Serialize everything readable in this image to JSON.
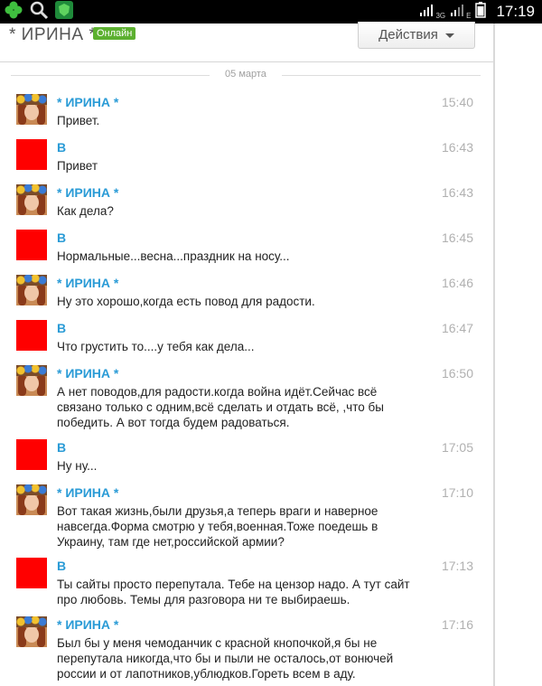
{
  "status_bar": {
    "time": "17:19",
    "network_1": "3G",
    "network_2": "E",
    "icons": [
      "clover-icon",
      "search-icon",
      "shield-app-icon",
      "signal-icon",
      "signal-icon",
      "battery-icon"
    ]
  },
  "header": {
    "chat_name": "* ИРИНА *",
    "online_badge": "Онлайн",
    "actions_label": "Действия"
  },
  "date_separator": "05 марта",
  "messages": [
    {
      "sender": "* ИРИНА *",
      "time": "15:40",
      "text": "Привет.",
      "avatar": "irina"
    },
    {
      "sender": "В",
      "time": "16:43",
      "text": "Привет",
      "avatar": "v"
    },
    {
      "sender": "* ИРИНА *",
      "time": "16:43",
      "text": "Как дела?",
      "avatar": "irina"
    },
    {
      "sender": "В",
      "time": "16:45",
      "text": "Нормальные...весна...праздник на носу...",
      "avatar": "v"
    },
    {
      "sender": "* ИРИНА *",
      "time": "16:46",
      "text": "Ну это хорошо,когда есть повод для радости.",
      "avatar": "irina"
    },
    {
      "sender": "В",
      "time": "16:47",
      "text": "Что грустить то....у тебя как дела...",
      "avatar": "v"
    },
    {
      "sender": "* ИРИНА *",
      "time": "16:50",
      "text": "А нет поводов,для радости.когда война идёт.Сейчас всё связано только с одним,всё сделать и отдать всё, ,что бы победить. А вот тогда будем радоваться.",
      "avatar": "irina"
    },
    {
      "sender": "В",
      "time": "17:05",
      "text": "Ну ну...",
      "avatar": "v"
    },
    {
      "sender": "* ИРИНА *",
      "time": "17:10",
      "text": "Вот такая жизнь,были друзья,а теперь враги и наверное навсегда.Форма смотрю у тебя,военная.Тоже поедешь в Украину, там где нет,российской армии?",
      "avatar": "irina"
    },
    {
      "sender": "В",
      "time": "17:13",
      "text": "Ты сайты просто перепутала. Тебе на цензор надо. А тут сайт про любовь. Темы для разговора ни те выбираешь.",
      "avatar": "v"
    },
    {
      "sender": "* ИРИНА *",
      "time": "17:16",
      "text": "Был бы у меня чемоданчик с красной кнопочкой,я бы не перепутала никогда,что бы и пыли не осталось,от вонючей россии и от лапотников,ублюдков.Гореть всем в аду.",
      "avatar": "irina"
    }
  ]
}
